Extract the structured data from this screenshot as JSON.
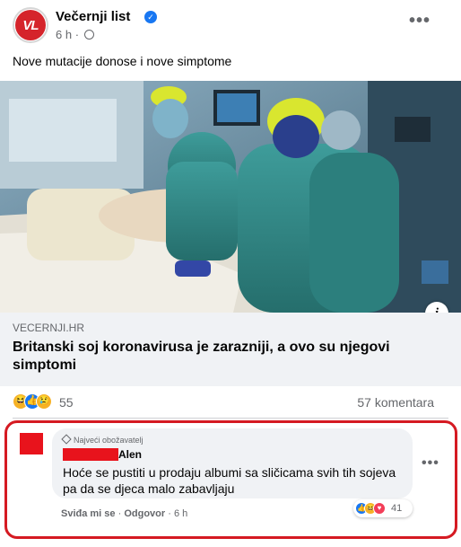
{
  "header": {
    "page_name": "Večernji list",
    "avatar_text": "VL",
    "time": "6 h",
    "more": "•••"
  },
  "post": {
    "text": "Nove mutacije donose i nove simptome"
  },
  "link": {
    "domain": "VECERNJI.HR",
    "title": "Britanski soj koronavirusa je zarazniji, a ovo su njegovi simptomi",
    "info": "i"
  },
  "stats": {
    "reaction_count": "55",
    "comments": "57 komentara"
  },
  "comment": {
    "badge": "Najveći obožavatelj",
    "author": "Alen",
    "text": "Hoće se pustiti u prodaju albumi sa sličicama svih tih sojeva pa da se djeca malo zabavljaju",
    "reaction_count": "41",
    "like_label": "Sviđa mi se",
    "reply_label": "Odgovor",
    "time": "6 h",
    "separator": "·"
  },
  "colors": {
    "facebook_blue": "#1877f2",
    "highlight_red": "#d51a22",
    "redaction_red": "#e8131c"
  }
}
